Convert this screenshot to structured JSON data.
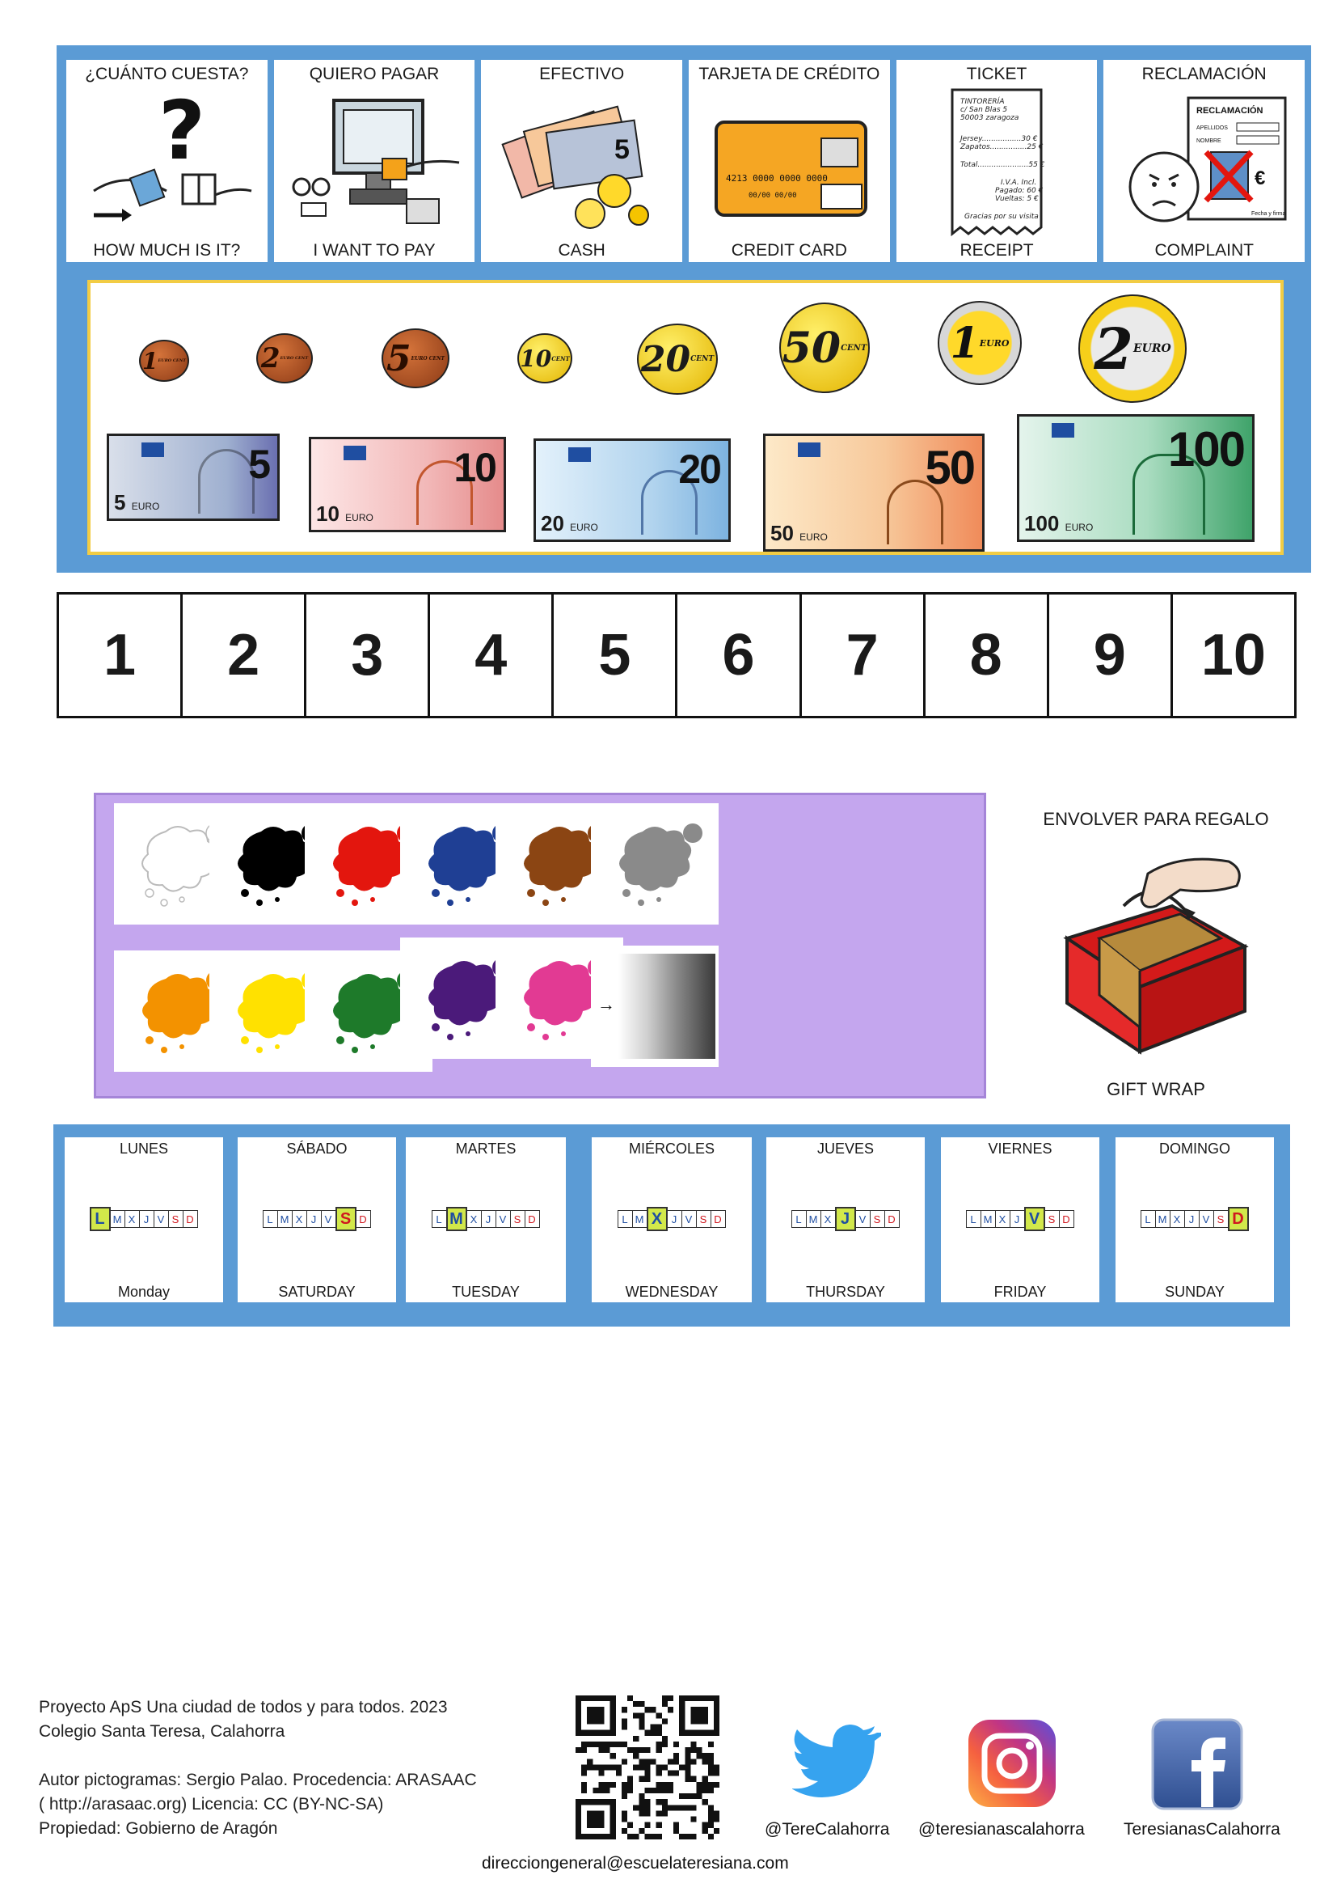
{
  "cards": [
    {
      "top": "¿CUÁNTO CUESTA?",
      "bottom": "HOW MUCH IS IT?",
      "icon": "price-question-icon"
    },
    {
      "top": "QUIERO PAGAR",
      "bottom": "I WANT TO PAY",
      "icon": "cash-register-icon"
    },
    {
      "top": "EFECTIVO",
      "bottom": "CASH",
      "icon": "cash-money-icon"
    },
    {
      "top": "TARJETA DE CRÉDITO",
      "bottom": "CREDIT CARD",
      "icon": "credit-card-icon",
      "card_number": "4213 0000 0000 0000",
      "card_dates": "00/00   00/00"
    },
    {
      "top": "TICKET",
      "bottom": "RECEIPT",
      "icon": "receipt-icon",
      "receipt_lines": [
        "TINTORERÍA",
        "c/ San Blas 5",
        "50003 zaragoza",
        "Jersey.................30 €",
        "Zapatos................25 €",
        "Total......................55 €",
        "I.V.A. Incl.",
        "Pagado: 60 €",
        "Vueltas: 5 €",
        "Gracias por su visita"
      ]
    },
    {
      "top": "RECLAMACIÓN",
      "bottom": "COMPLAINT",
      "icon": "complaint-form-icon",
      "form_title": "RECLAMACIÓN",
      "form_fields": [
        "APELLIDOS",
        "NOMBRE"
      ],
      "form_footer": "Fecha y firma"
    }
  ],
  "coins": [
    {
      "value": "1",
      "sub": "EURO CENT",
      "type": "copper"
    },
    {
      "value": "2",
      "sub": "EURO CENT",
      "type": "copper"
    },
    {
      "value": "5",
      "sub": "EURO CENT",
      "type": "copper"
    },
    {
      "value": "10",
      "sub": "CENT",
      "type": "gold"
    },
    {
      "value": "20",
      "sub": "CENT",
      "type": "gold"
    },
    {
      "value": "50",
      "sub": "CENT",
      "type": "gold"
    },
    {
      "value": "1",
      "sub": "EURO",
      "type": "bi"
    },
    {
      "value": "2",
      "sub": "EURO",
      "type": "bi2"
    }
  ],
  "notes": [
    {
      "value": "5",
      "euro": "5",
      "unit": "EURO",
      "color": "#b7c3d8"
    },
    {
      "value": "10",
      "euro": "10",
      "unit": "EURO",
      "color": "#f2c7c7"
    },
    {
      "value": "20",
      "euro": "20",
      "unit": "EURO",
      "color": "#b9d6ee"
    },
    {
      "value": "50",
      "euro": "50",
      "unit": "EURO",
      "color": "#f7c89a"
    },
    {
      "value": "100",
      "euro": "100",
      "unit": "EURO",
      "color": "#9fd2b4"
    }
  ],
  "numbers": [
    "1",
    "2",
    "3",
    "4",
    "5",
    "6",
    "7",
    "8",
    "9",
    "10"
  ],
  "colors": {
    "row1": [
      "#ffffff",
      "#000000",
      "#e3160e",
      "#1f3f94",
      "#8b4513",
      "#8a8a8a"
    ],
    "row2": [
      "#f39200",
      "#ffe100",
      "#1e7a2a",
      "#4b1a7a",
      "#e23a93"
    ]
  },
  "gift": {
    "top": "ENVOLVER PARA REGALO",
    "bottom": "GIFT WRAP"
  },
  "day_letters": [
    "L",
    "M",
    "X",
    "J",
    "V",
    "S",
    "D"
  ],
  "days": [
    {
      "top": "LUNES",
      "bottom": "Monday",
      "active": 0
    },
    {
      "top": "SÁBADO",
      "bottom": "SATURDAY",
      "active": 5
    },
    {
      "top": "MARTES",
      "bottom": "TUESDAY",
      "active": 1
    },
    {
      "top": "MIÉRCOLES",
      "bottom": "WEDNESDAY",
      "active": 2
    },
    {
      "top": "JUEVES",
      "bottom": "THURSDAY",
      "active": 3
    },
    {
      "top": "VIERNES",
      "bottom": "FRIDAY",
      "active": 4
    },
    {
      "top": "DOMINGO",
      "bottom": "SUNDAY",
      "active": 6
    }
  ],
  "footer": {
    "lines": [
      "Proyecto ApS Una ciudad de todos y para todos. 2023",
      "Colegio Santa Teresa, Calahorra",
      "",
      "Autor pictogramas: Sergio Palao. Procedencia: ARASAAC",
      "( http://arasaac.org) Licencia: CC (BY-NC-SA)",
      "Propiedad: Gobierno de Aragón"
    ],
    "twitter": "@TereCalahorra",
    "instagram": "@teresianascalahorra",
    "facebook": "TeresianasCalahorra",
    "email": "direcciongeneral@escuelateresiana.com"
  }
}
